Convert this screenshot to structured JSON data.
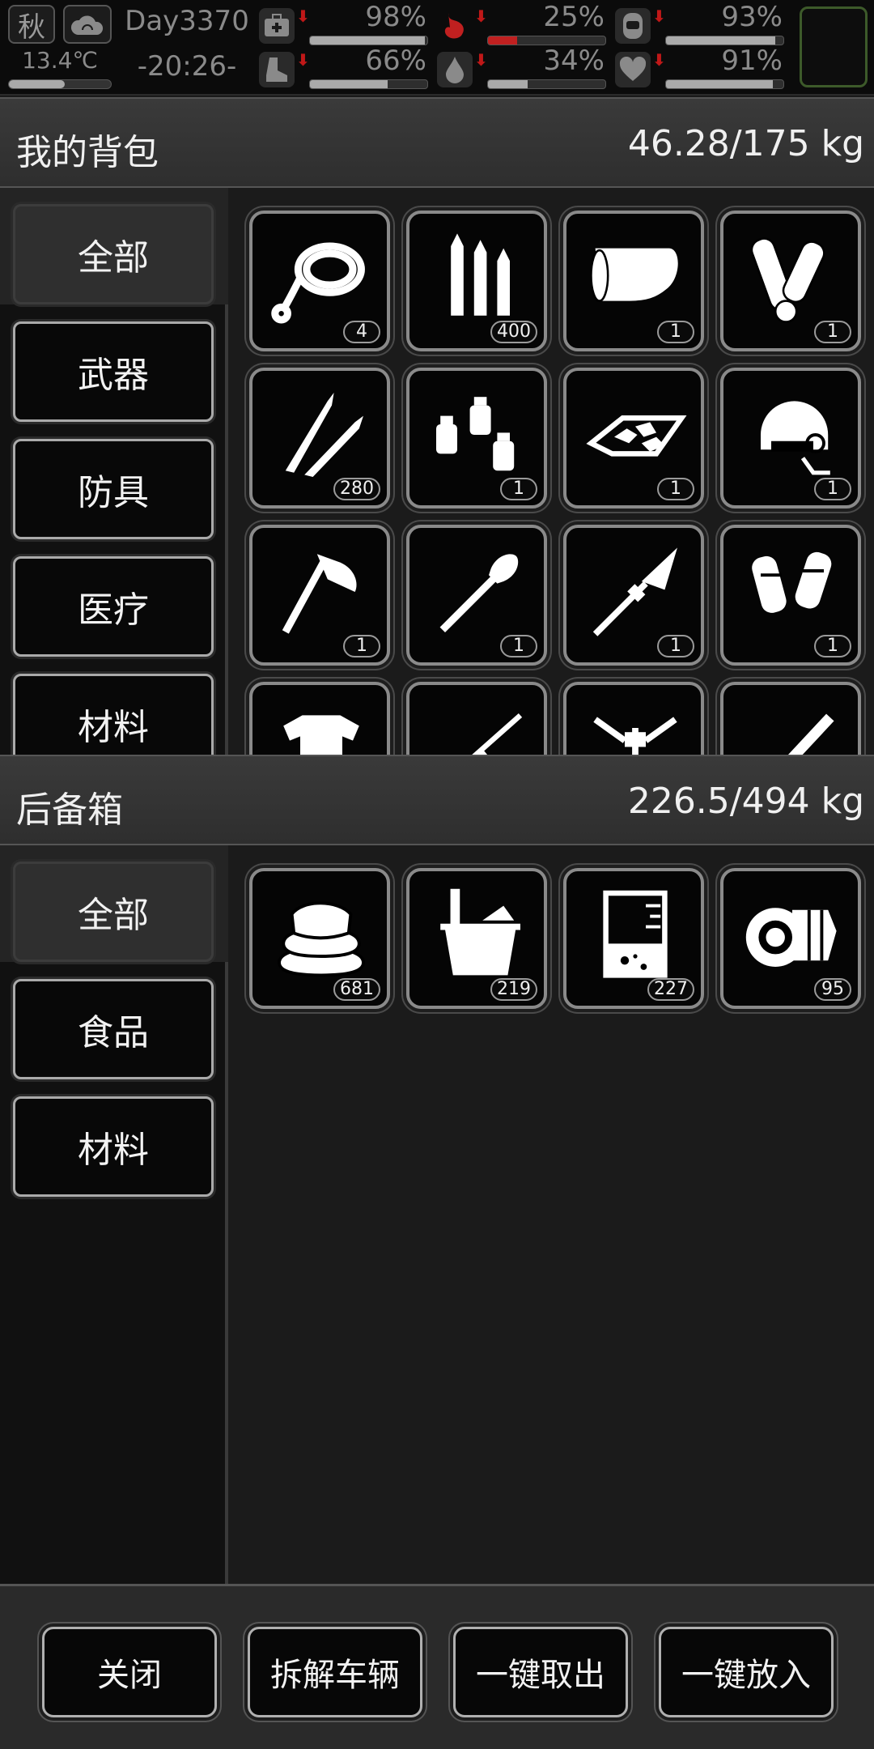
{
  "status": {
    "season": "秋",
    "weather_icon": "cloud-icon",
    "temperature": "13.4℃",
    "temperature_level": 0.55,
    "day": "Day3370",
    "time": "-20:26-",
    "stats": [
      {
        "icon": "medkit-icon",
        "value": "98%",
        "level": 0.98,
        "trend": "down"
      },
      {
        "icon": "stomach-icon",
        "value": "25%",
        "level": 0.25,
        "trend": "down",
        "color": "#c02020"
      },
      {
        "icon": "shield-icon",
        "value": "93%",
        "level": 0.93,
        "trend": "down"
      },
      {
        "icon": "boot-icon",
        "value": "66%",
        "level": 0.66,
        "trend": "down"
      },
      {
        "icon": "water-drop-icon",
        "value": "34%",
        "level": 0.34,
        "trend": "down"
      },
      {
        "icon": "heart-icon",
        "value": "91%",
        "level": 0.91,
        "trend": "down"
      }
    ]
  },
  "backpack": {
    "title": "我的背包",
    "weight": "46.28/175 kg",
    "categories": [
      "全部",
      "武器",
      "防具",
      "医疗",
      "材料"
    ],
    "items": [
      {
        "icon": "rope-icon",
        "count": "4"
      },
      {
        "icon": "bullets-icon",
        "count": "400"
      },
      {
        "icon": "cloth-roll-icon",
        "count": "1"
      },
      {
        "icon": "bandage-icon",
        "count": "1"
      },
      {
        "icon": "rifle-rounds-icon",
        "count": "280"
      },
      {
        "icon": "grenades-icon",
        "count": "1"
      },
      {
        "icon": "food-tray-icon",
        "count": "1"
      },
      {
        "icon": "helmet-icon",
        "count": "1"
      },
      {
        "icon": "axe-icon",
        "count": "1"
      },
      {
        "icon": "shovel-icon",
        "count": "1"
      },
      {
        "icon": "spear-icon",
        "count": "1"
      },
      {
        "icon": "arm-guards-icon",
        "count": "1"
      },
      {
        "icon": "body-armor-icon",
        "count": ""
      },
      {
        "icon": "sniper-rifle-icon",
        "count": ""
      },
      {
        "icon": "tripod-icon",
        "count": ""
      },
      {
        "icon": "minigun-icon",
        "count": ""
      }
    ]
  },
  "trunk": {
    "title": "后备箱",
    "weight": "226.5/494 kg",
    "categories": [
      "全部",
      "食品",
      "材料"
    ],
    "items": [
      {
        "icon": "cloth-stack-icon",
        "count": "681"
      },
      {
        "icon": "water-bucket-icon",
        "count": "219"
      },
      {
        "icon": "beaker-icon",
        "count": "227"
      },
      {
        "icon": "gear-part-icon",
        "count": "95"
      }
    ]
  },
  "actions": [
    "关闭",
    "拆解车辆",
    "一键取出",
    "一键放入"
  ]
}
